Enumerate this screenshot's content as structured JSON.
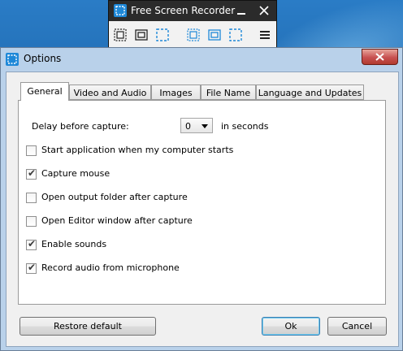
{
  "recorder": {
    "title": "Free Screen Recorder",
    "icons": [
      "app-logo-icon",
      "minimize-icon",
      "close-icon"
    ],
    "tools": [
      "capture-region-icon",
      "capture-window-icon",
      "capture-fullscreen-icon",
      "record-region-icon",
      "record-window-icon",
      "record-fullscreen-icon",
      "menu-icon"
    ]
  },
  "dialog": {
    "title": "Options",
    "tabs": [
      "General",
      "Video and Audio",
      "Images",
      "File Name",
      "Language and Updates"
    ],
    "active_tab": "General",
    "delay": {
      "label": "Delay before capture:",
      "value": "0",
      "unit": "in seconds"
    },
    "checkboxes": [
      {
        "label": "Start application when my computer starts",
        "checked": false
      },
      {
        "label": "Capture mouse",
        "checked": true
      },
      {
        "label": "Open output folder after capture",
        "checked": false
      },
      {
        "label": "Open Editor window after capture",
        "checked": false
      },
      {
        "label": "Enable sounds",
        "checked": true
      },
      {
        "label": "Record audio from microphone",
        "checked": true
      }
    ],
    "buttons": {
      "restore": "Restore default",
      "ok": "Ok",
      "cancel": "Cancel"
    },
    "close_glyph": "✕"
  },
  "colors": {
    "accent": "#1e88d8",
    "desktop": "#1f6fb8",
    "close_red": "#c75050"
  }
}
